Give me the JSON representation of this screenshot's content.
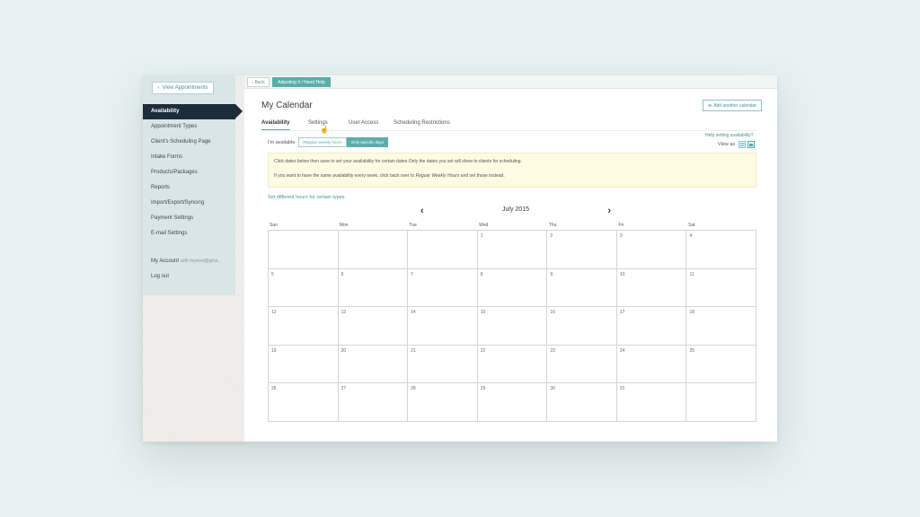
{
  "sidebar": {
    "view_appointments": "View Appointments",
    "items": [
      {
        "label": "Availability",
        "active": true
      },
      {
        "label": "Appointment Types"
      },
      {
        "label": "Client's Scheduling Page"
      },
      {
        "label": "Intake Forms"
      },
      {
        "label": "Products/Packages"
      },
      {
        "label": "Reports"
      },
      {
        "label": "Import/Export/Syncing"
      },
      {
        "label": "Payment Settings"
      },
      {
        "label": "E-mail Settings"
      }
    ],
    "my_account": "My Account",
    "account_email": "with myreed@gma...",
    "log_out": "Log out"
  },
  "topbar": {
    "back": "Back",
    "help": "Adjusting It / Need Help"
  },
  "page": {
    "title": "My Calendar",
    "add_calendar": "Add another calendar"
  },
  "tabs": [
    "Availability",
    "Settings",
    "User Access",
    "Scheduling Restrictions"
  ],
  "availability": {
    "label": "I'm available",
    "option_regular": "Regular weekly hours",
    "option_specific": "Only specific days",
    "help_link": "Help setting availability?",
    "view_as": "View as"
  },
  "notice": {
    "line1": "Click dates below then save to set your availability for certain dates Only the dates you set will show to clients for scheduling.",
    "line2_pre": "If you want to have the same availability every week, click back over to ",
    "line2_em": "Reguar Weekly Hours",
    "line2_post": " and set those instead."
  },
  "set_hours_link": "Set different hours for certain types.",
  "calendar": {
    "month": "July 2015",
    "days_of_week": [
      "Sun",
      "Mon",
      "Tue",
      "Wed",
      "Thu",
      "Fri",
      "Sat"
    ],
    "weeks": [
      [
        "",
        "",
        "",
        "1",
        "2",
        "3",
        "4"
      ],
      [
        "5",
        "6",
        "7",
        "8",
        "9",
        "10",
        "11"
      ],
      [
        "12",
        "13",
        "14",
        "15",
        "16",
        "17",
        "18"
      ],
      [
        "19",
        "20",
        "21",
        "22",
        "23",
        "24",
        "25"
      ],
      [
        "26",
        "27",
        "28",
        "29",
        "30",
        "31",
        ""
      ]
    ]
  },
  "colors": {
    "accent": "#5aaeaa",
    "nav_active": "#1e2b3a",
    "notice_bg": "#fdfbe1"
  }
}
